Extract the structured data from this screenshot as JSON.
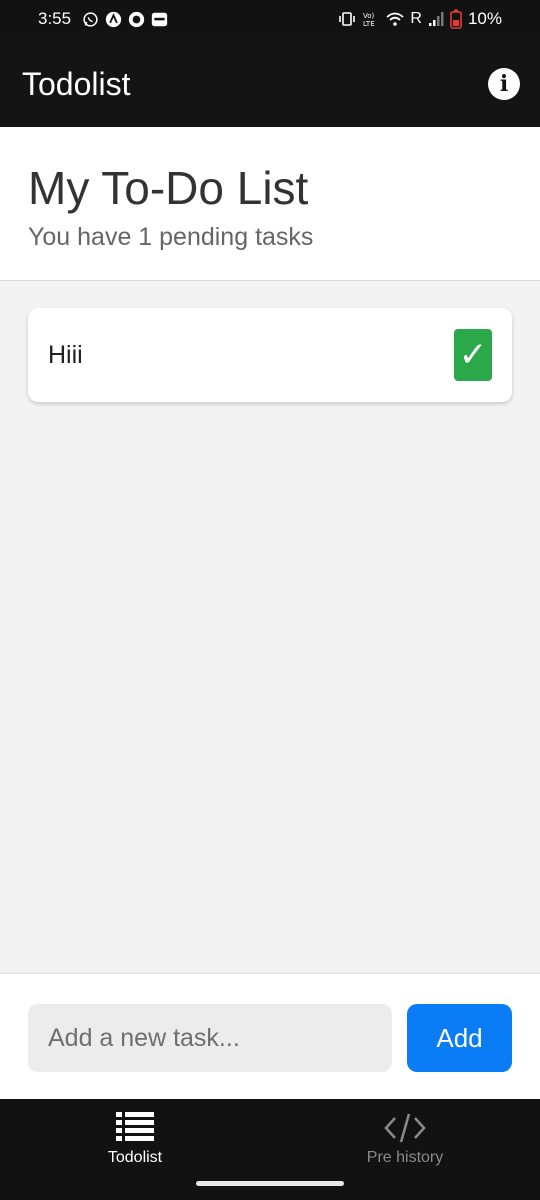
{
  "status_bar": {
    "time": "3:55",
    "battery_text": "10%",
    "network_text": "R"
  },
  "app_bar": {
    "title": "Todolist",
    "info_icon": "info-circle-icon"
  },
  "header": {
    "title": "My To-Do List",
    "subtitle": "You have 1 pending tasks"
  },
  "tasks": [
    {
      "text": "Hiii",
      "done": true
    }
  ],
  "input": {
    "placeholder": "Add a new task...",
    "value": "",
    "add_label": "Add"
  },
  "bottom_nav": {
    "items": [
      {
        "label": "Todolist",
        "icon": "list-icon",
        "active": true
      },
      {
        "label": "Pre history",
        "icon": "code-icon",
        "active": false
      }
    ]
  },
  "colors": {
    "accent": "#0a7cf5",
    "check": "#2aa84a",
    "app_bar_bg": "#141414",
    "battery_low": "#e53935"
  }
}
